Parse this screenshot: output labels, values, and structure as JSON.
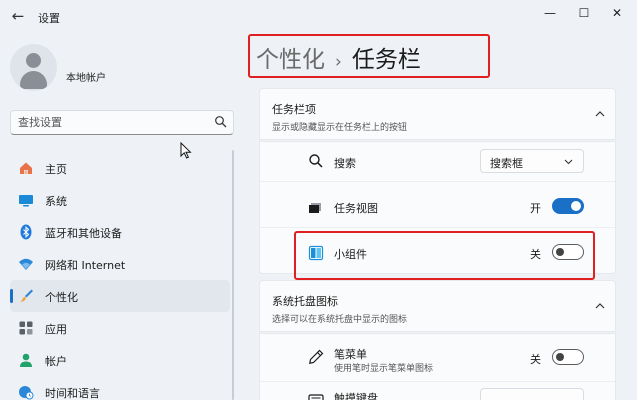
{
  "window": {
    "app_title": "设置",
    "back_icon": "arrow-left-icon",
    "min_icon": "minimize-icon",
    "max_icon": "maximize-icon",
    "close_icon": "close-icon"
  },
  "account": {
    "name": "本地帐户"
  },
  "search": {
    "placeholder": "查找设置",
    "icon": "search-icon"
  },
  "sidebar": {
    "active_index": 4,
    "accent": "#1a6fc6",
    "items": [
      {
        "label": "主页",
        "icon": "home-icon"
      },
      {
        "label": "系统",
        "icon": "monitor-icon"
      },
      {
        "label": "蓝牙和其他设备",
        "icon": "bluetooth-icon"
      },
      {
        "label": "网络和 Internet",
        "icon": "wifi-icon"
      },
      {
        "label": "个性化",
        "icon": "paintbrush-icon"
      },
      {
        "label": "应用",
        "icon": "apps-icon"
      },
      {
        "label": "帐户",
        "icon": "person-icon"
      },
      {
        "label": "时间和语言",
        "icon": "globe-clock-icon"
      }
    ]
  },
  "breadcrumb": {
    "parent": "个性化",
    "separator": "›",
    "current": "任务栏"
  },
  "taskbar_items": {
    "title": "任务栏项",
    "description": "显示或隐藏显示在任务栏上的按钮",
    "rows": [
      {
        "label": "搜索",
        "icon": "search-icon",
        "control": "dropdown",
        "value": "搜索框"
      },
      {
        "label": "任务视图",
        "icon": "task-view-icon",
        "control": "toggle",
        "state": "开",
        "on": true
      },
      {
        "label": "小组件",
        "icon": "widgets-icon",
        "control": "toggle",
        "state": "关",
        "on": false
      }
    ]
  },
  "tray_icons": {
    "title": "系统托盘图标",
    "description": "选择可以在系统托盘中显示的图标",
    "rows": [
      {
        "label": "笔菜单",
        "description": "使用笔时显示笔菜单图标",
        "icon": "pen-icon",
        "control": "toggle",
        "state": "关",
        "on": false
      },
      {
        "label": "触摸键盘",
        "description": "",
        "icon": "keyboard-icon",
        "control": "dropdown",
        "value": ""
      }
    ]
  },
  "colors": {
    "accent": "#1a6fc6",
    "highlight": "#e02020",
    "background": "#eef1f6"
  }
}
